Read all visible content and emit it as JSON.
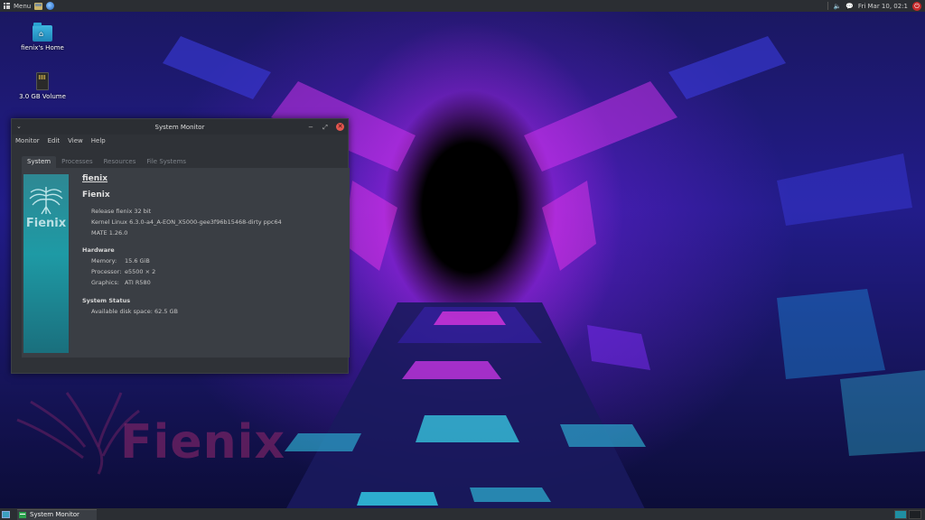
{
  "top_panel": {
    "menu_label": "Menu",
    "clock": "Fri Mar 10, 02:1",
    "tray_speaker": "🔈",
    "tray_chat": "💬",
    "power_glyph": "⏻"
  },
  "desktop": {
    "icons": [
      {
        "label": "fienix's Home"
      },
      {
        "label": "3.0 GB Volume"
      }
    ],
    "watermark_text": "Fienix"
  },
  "window": {
    "title": "System Monitor",
    "menu_icon": "⌄",
    "controls": {
      "minimize": "−",
      "maximize": "⤢",
      "close": "✕"
    },
    "menubar": [
      "Monitor",
      "Edit",
      "View",
      "Help"
    ],
    "tabs": [
      "System",
      "Processes",
      "Resources",
      "File Systems"
    ],
    "active_tab": "System",
    "system": {
      "logo_text": "Fienix",
      "hostname": "fienix",
      "distro": "Fienix",
      "release": "Release fienix 32 bit",
      "kernel": "Kernel Linux 6.3.0-a4_A-EON_X5000-gee3f96b15468-dirty ppc64",
      "mate": "MATE 1.26.0",
      "hardware_heading": "Hardware",
      "memory_label": "Memory:",
      "memory_value": "15.6 GiB",
      "processor_label": "Processor:",
      "processor_value": "e5500 × 2",
      "graphics_label": "Graphics:",
      "graphics_value": "ATI R580",
      "status_heading": "System Status",
      "disk_label": "Available disk space:",
      "disk_value": "62.5 GB"
    }
  },
  "taskbar": {
    "task_label": "System Monitor"
  },
  "colors": {
    "panel": "#2b2e33",
    "window_bg": "#2f3237",
    "accent_teal": "#1e9aa5",
    "close_red": "#e3564f"
  }
}
